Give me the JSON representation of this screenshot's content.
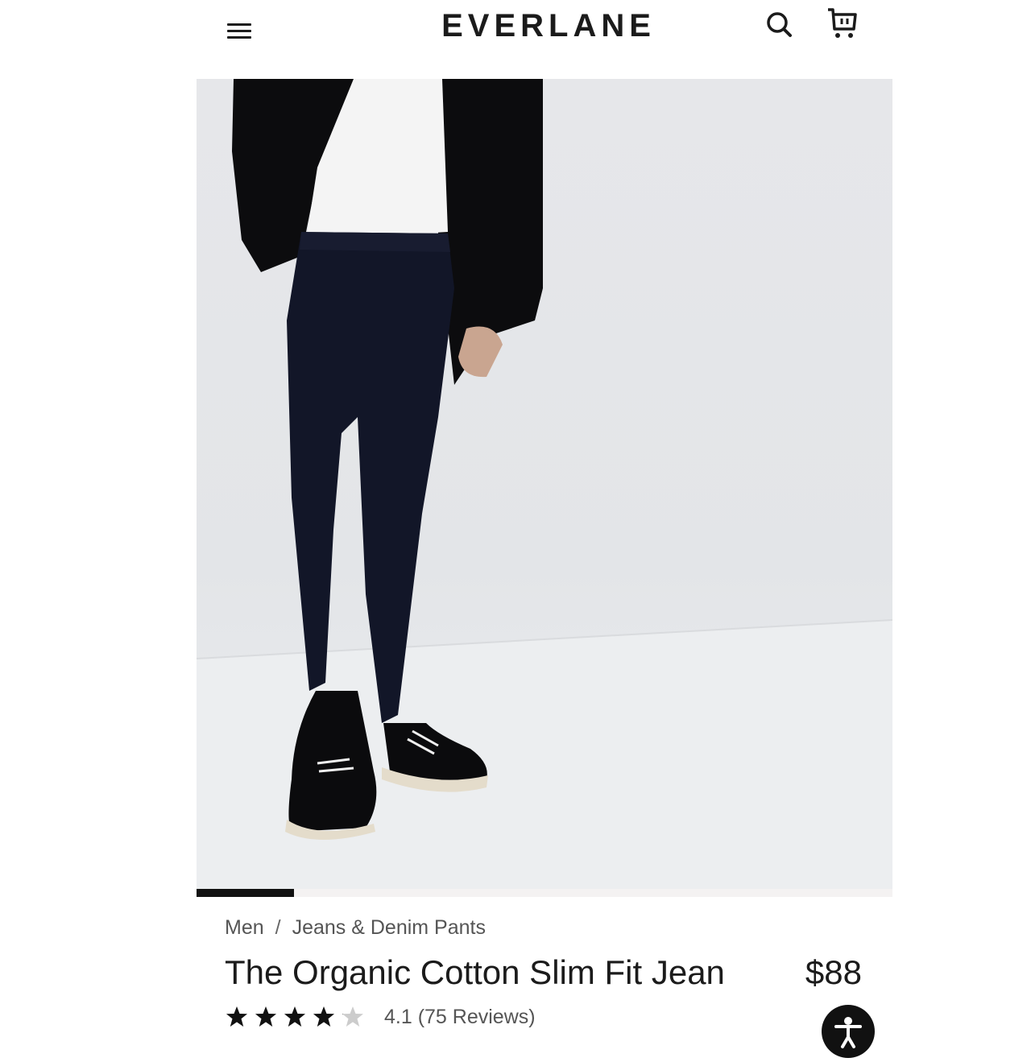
{
  "header": {
    "logo": "EVERLANE",
    "icons": {
      "menu": "menu-icon",
      "search": "search-icon",
      "cart": "cart-icon"
    }
  },
  "gallery": {
    "image_alt": "Model wearing The Organic Cotton Slim Fit Jean",
    "active_index": 1,
    "progress_fraction": 0.14
  },
  "breadcrumb": {
    "items": [
      "Men",
      "Jeans & Denim Pants"
    ],
    "separator": "/"
  },
  "product": {
    "title": "The Organic Cotton Slim Fit Jean",
    "price": "$88"
  },
  "rating": {
    "value": 4.1,
    "max": 5,
    "text": "4.1 (75 Reviews)"
  },
  "colors": {
    "text": "#1b1b1b",
    "muted": "#555555",
    "star": "#111111",
    "star_empty": "#cccccc"
  }
}
